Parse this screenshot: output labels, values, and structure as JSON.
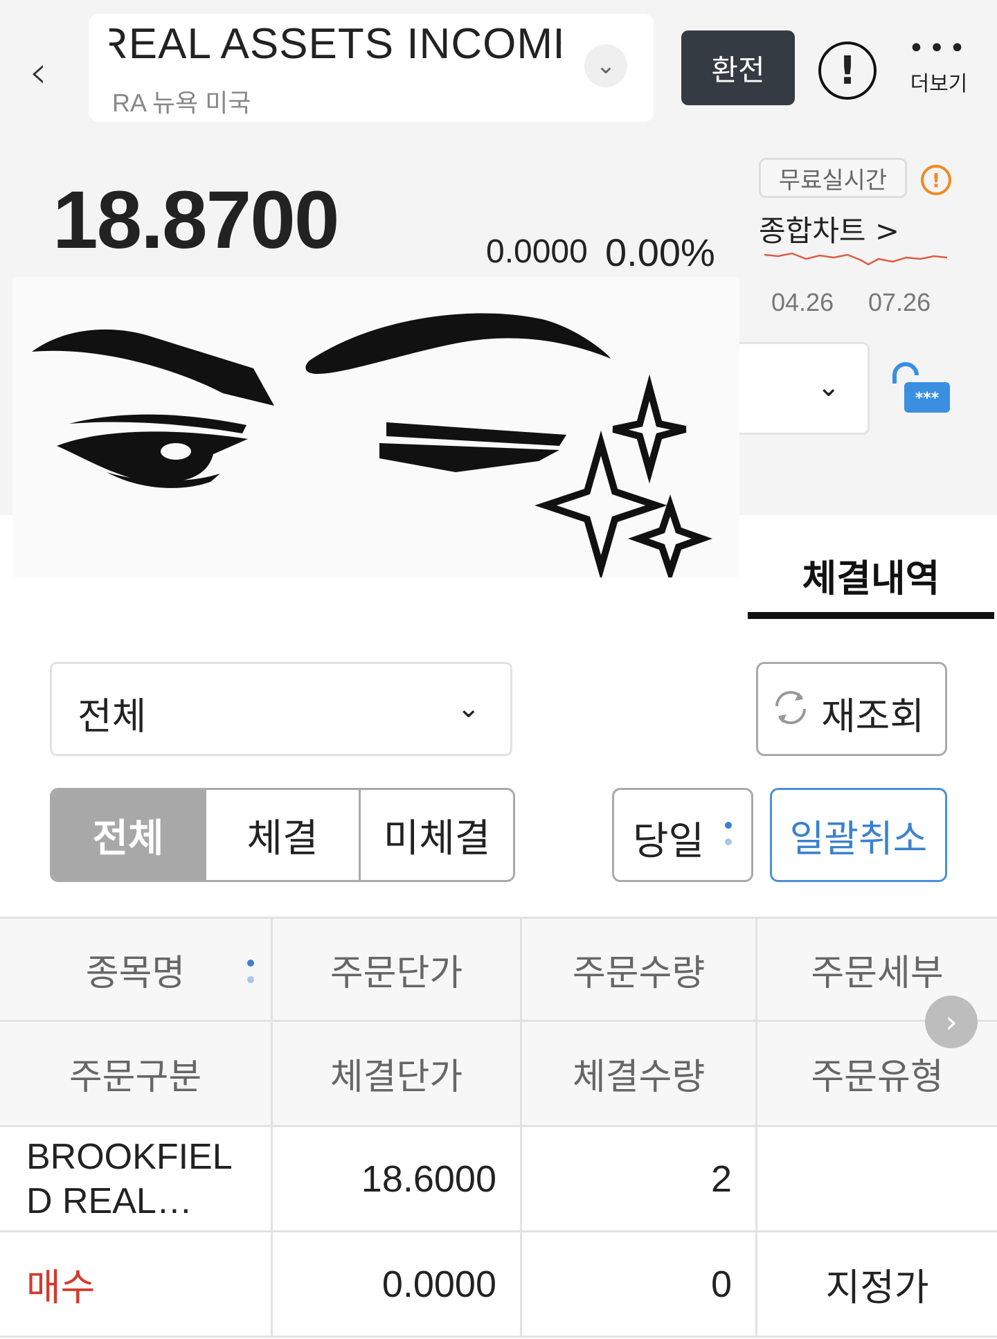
{
  "header": {
    "stock_name": "REAL ASSETS INCOME",
    "stock_sub": "RA  뉴욕  미국",
    "exchange_button": "환전",
    "more_label": "더보기"
  },
  "quote": {
    "price": "18.8700",
    "change": "0.0000",
    "change_pct": "0.00%",
    "realtime_badge": "무료실시간",
    "chart_link": "종합차트  >",
    "spark_dates": [
      "04.26",
      "07.26"
    ],
    "spark_color": "#e05a40",
    "lock_mask": "***"
  },
  "tabs": {
    "active": "체결내역"
  },
  "filters": {
    "select_value": "전체",
    "refresh_label": "재조회",
    "segments": [
      "전체",
      "체결",
      "미체결"
    ],
    "date_label": "당일",
    "cancel_all_label": "일괄취소"
  },
  "table": {
    "header_row1": [
      "종목명",
      "주문단가",
      "주문수량",
      "주문세부"
    ],
    "header_row2": [
      "주문구분",
      "체결단가",
      "체결수량",
      "주문유형"
    ],
    "rows": [
      {
        "name": "BROOKFIEL D REAL…",
        "order_price": "18.6000",
        "order_qty": "2",
        "order_detail": "",
        "order_side": "매수",
        "exec_price": "0.0000",
        "exec_qty": "0",
        "order_type": "지정가"
      }
    ]
  },
  "colors": {
    "accent_blue": "#3a82cf",
    "buy_red": "#d33a2c",
    "dark_button": "#353b42"
  }
}
